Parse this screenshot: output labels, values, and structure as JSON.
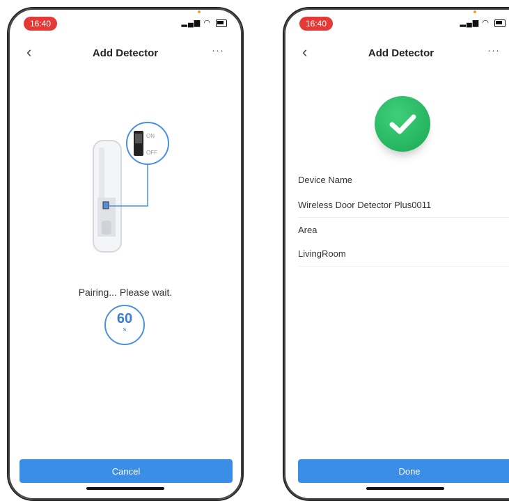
{
  "status_bar": {
    "time": "16:40"
  },
  "left": {
    "nav": {
      "back": "‹",
      "title": "Add Detector",
      "more": "···"
    },
    "illustration": {
      "on_label": "ON",
      "off_label": "OFF"
    },
    "pairing_text": "Pairing... Please wait.",
    "countdown": {
      "value": "60",
      "unit": "s"
    },
    "cancel_label": "Cancel"
  },
  "right": {
    "nav": {
      "back": "‹",
      "title": "Add Detector",
      "more": "···"
    },
    "device_name_label": "Device Name",
    "device_name_value": "Wireless Door Detector Plus0011",
    "area_label": "Area",
    "area_value": "LivingRoom",
    "done_label": "Done"
  },
  "colors": {
    "accent": "#3a8ee6",
    "success": "#1aa855",
    "time_pill": "#e53935"
  },
  "icons": [
    "back-chevron-icon",
    "more-icon",
    "signal-icon",
    "wifi-icon",
    "battery-icon",
    "checkmark-icon"
  ]
}
